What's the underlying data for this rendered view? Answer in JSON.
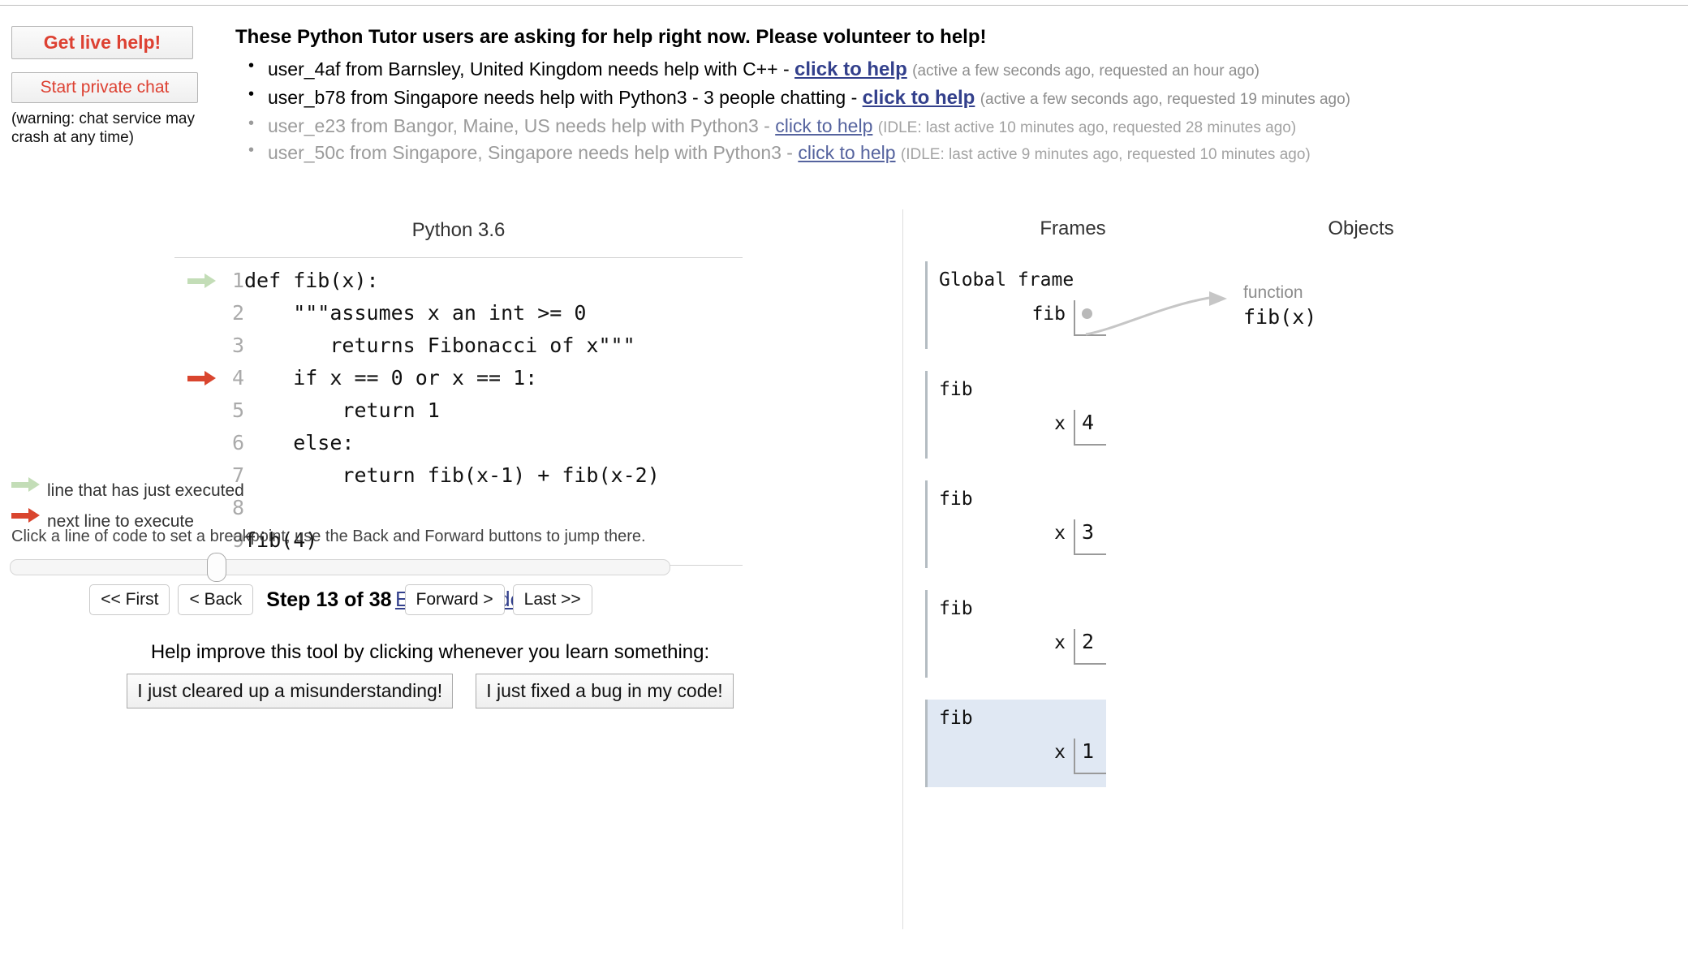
{
  "chat": {
    "get_live_help_label": "Get live help!",
    "start_private_chat_label": "Start private chat",
    "warning": "(warning: chat service may crash at any time)"
  },
  "help_banner": {
    "headline": "These Python Tutor users are asking for help right now. Please volunteer to help!",
    "requests": [
      {
        "description": "user_4af from Barnsley, United Kingdom needs help with C++ - ",
        "link": "click to help",
        "meta": "(active a few seconds ago, requested an hour ago)",
        "state": "active"
      },
      {
        "description": "user_b78 from Singapore needs help with Python3 - 3 people chatting - ",
        "link": "click to help",
        "meta": "(active a few seconds ago, requested 19 minutes ago)",
        "state": "active"
      },
      {
        "description": "user_e23 from Bangor, Maine, US needs help with Python3 - ",
        "link": "click to help",
        "meta": "(IDLE: last active 10 minutes ago, requested 28 minutes ago)",
        "state": "idle"
      },
      {
        "description": "user_50c from Singapore, Singapore needs help with Python3 - ",
        "link": "click to help",
        "meta": "(IDLE: last active 9 minutes ago, requested 10 minutes ago)",
        "state": "idle"
      }
    ]
  },
  "code_panel": {
    "language_label": "Python 3.6",
    "edit_link": "Edit this code",
    "lines": [
      {
        "number": "1",
        "text": "def fib(x):",
        "arrow": "green-arrow-icon"
      },
      {
        "number": "2",
        "text": "    \"\"\"assumes x an int >= 0",
        "arrow": ""
      },
      {
        "number": "3",
        "text": "       returns Fibonacci of x\"\"\"",
        "arrow": ""
      },
      {
        "number": "4",
        "text": "    if x == 0 or x == 1:",
        "arrow": "red-arrow-icon"
      },
      {
        "number": "5",
        "text": "        return 1",
        "arrow": ""
      },
      {
        "number": "6",
        "text": "    else:",
        "arrow": ""
      },
      {
        "number": "7",
        "text": "        return fib(x-1) + fib(x-2)",
        "arrow": ""
      },
      {
        "number": "8",
        "text": "",
        "arrow": ""
      },
      {
        "number": "9",
        "text": "fib(4)",
        "arrow": ""
      }
    ]
  },
  "legend": {
    "executed": "line that has just executed",
    "next": "next line to execute",
    "breakpoint_hint": "Click a line of code to set a breakpoint; use the Back and Forward buttons to jump there."
  },
  "controls": {
    "first_label": "<< First",
    "back_label": "< Back",
    "step_counter": "Step 13 of 38",
    "forward_label": "Forward >",
    "last_label": "Last >>",
    "step_current": 13,
    "step_total": 38
  },
  "feedback": {
    "prompt": "Help improve this tool by clicking whenever you learn something:",
    "cleared_up_label": "I just cleared up a misunderstanding!",
    "fixed_bug_label": "I just fixed a bug in my code!"
  },
  "visualization": {
    "frames_header": "Frames",
    "objects_header": "Objects",
    "frames": [
      {
        "title": "Global frame",
        "highlighted": false,
        "vars": [
          {
            "name": "fib",
            "value": "",
            "is_pointer": true
          }
        ]
      },
      {
        "title": "fib",
        "highlighted": false,
        "vars": [
          {
            "name": "x",
            "value": "4",
            "is_pointer": false
          }
        ]
      },
      {
        "title": "fib",
        "highlighted": false,
        "vars": [
          {
            "name": "x",
            "value": "3",
            "is_pointer": false
          }
        ]
      },
      {
        "title": "fib",
        "highlighted": false,
        "vars": [
          {
            "name": "x",
            "value": "2",
            "is_pointer": false
          }
        ]
      },
      {
        "title": "fib",
        "highlighted": true,
        "vars": [
          {
            "name": "x",
            "value": "1",
            "is_pointer": false
          }
        ]
      }
    ],
    "objects": [
      {
        "type": "function",
        "label": "fib(x)"
      }
    ]
  },
  "colors": {
    "accent_red": "#dd4132",
    "link_blue": "#33408c",
    "next_line_arrow": "#d9452e",
    "executed_line_arrow": "#c3ddb7",
    "highlight_frame_bg": "#e0e8f3",
    "pointer_gray": "#b9b9b9"
  }
}
